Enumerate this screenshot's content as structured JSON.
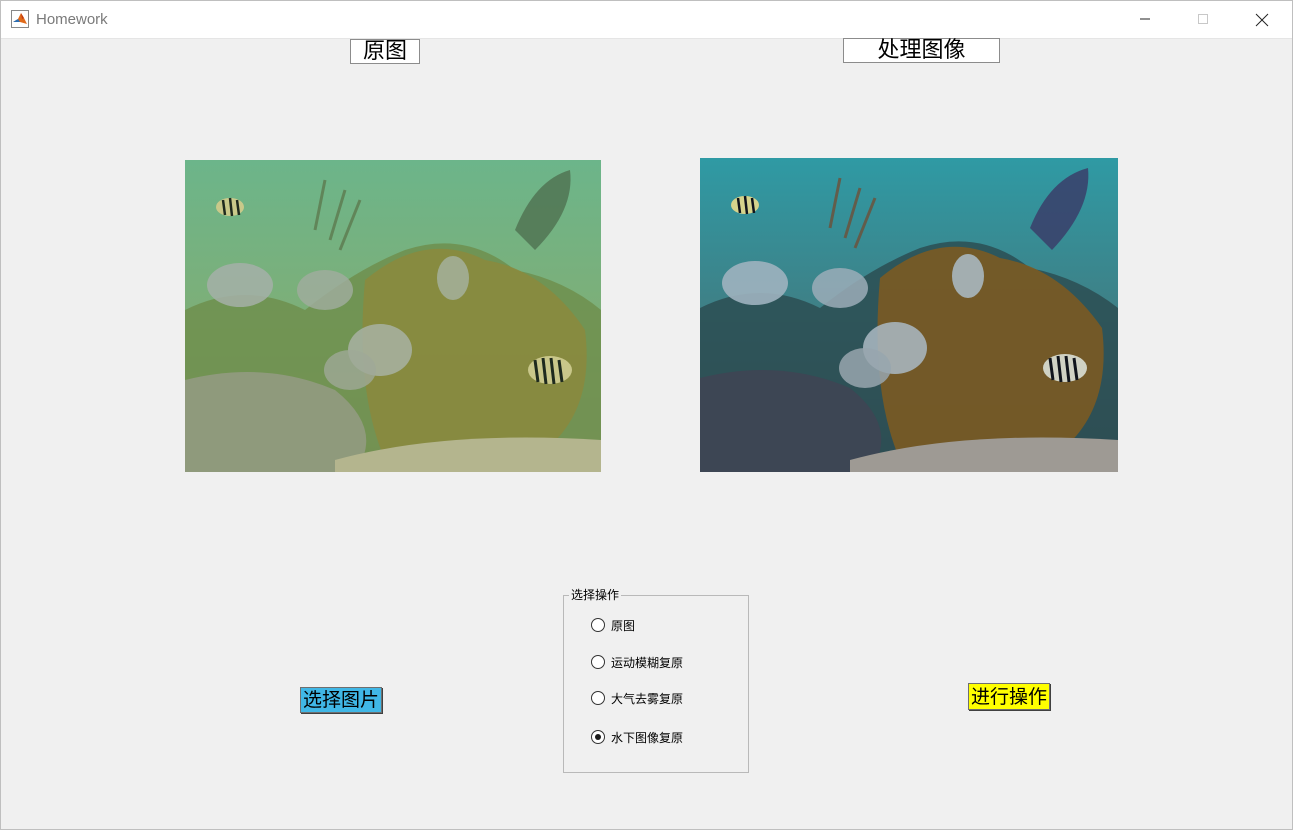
{
  "window": {
    "title": "Homework"
  },
  "labels": {
    "original": "原图",
    "processed": "处理图像"
  },
  "buttons": {
    "select_image": "选择图片",
    "run": "进行操作"
  },
  "colors": {
    "select_button": "#40b7e6",
    "run_button": "#ffff00"
  },
  "operation_group": {
    "title": "选择操作",
    "options": [
      {
        "label": "原图",
        "checked": false
      },
      {
        "label": "运动模糊复原",
        "checked": false
      },
      {
        "label": "大气去雾复原",
        "checked": false
      },
      {
        "label": "水下图像复原",
        "checked": true
      }
    ]
  },
  "images": {
    "original": "underwater-coral-reef-photo-greenish",
    "processed": "underwater-coral-reef-photo-restored"
  }
}
